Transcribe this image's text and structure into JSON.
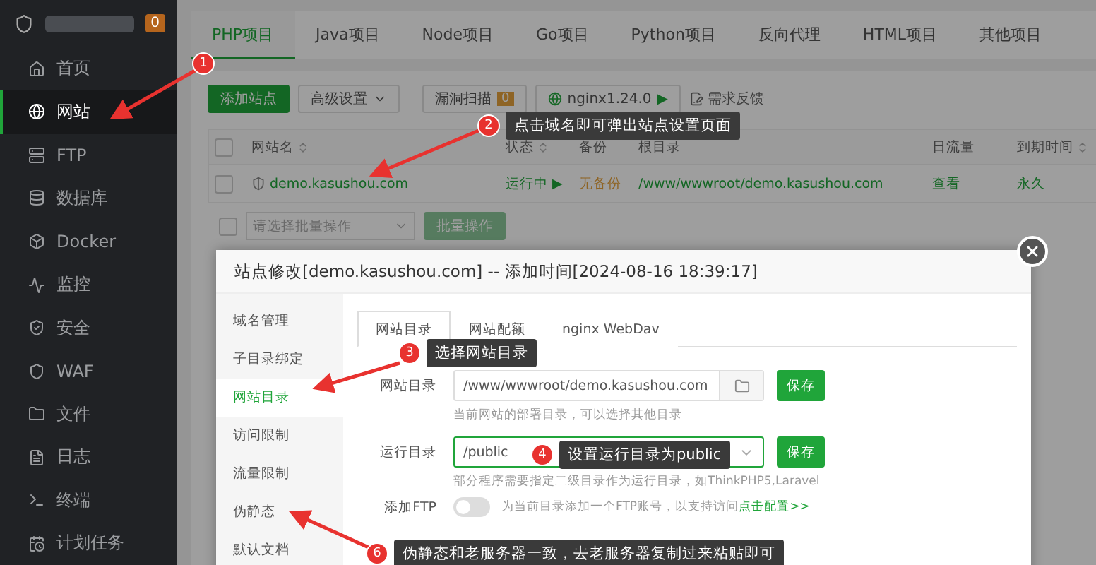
{
  "sidebar": {
    "badge": "0",
    "items": [
      {
        "label": "首页",
        "selected": false
      },
      {
        "label": "网站",
        "selected": true
      },
      {
        "label": "FTP",
        "selected": false
      },
      {
        "label": "数据库",
        "selected": false
      },
      {
        "label": "Docker",
        "selected": false
      },
      {
        "label": "监控",
        "selected": false
      },
      {
        "label": "安全",
        "selected": false
      },
      {
        "label": "WAF",
        "selected": false
      },
      {
        "label": "文件",
        "selected": false
      },
      {
        "label": "日志",
        "selected": false
      },
      {
        "label": "终端",
        "selected": false
      },
      {
        "label": "计划任务",
        "selected": false
      }
    ]
  },
  "project_tabs": [
    {
      "label": "PHP项目",
      "selected": true
    },
    {
      "label": "Java项目",
      "selected": false
    },
    {
      "label": "Node项目",
      "selected": false
    },
    {
      "label": "Go项目",
      "selected": false
    },
    {
      "label": "Python项目",
      "selected": false
    },
    {
      "label": "反向代理",
      "selected": false
    },
    {
      "label": "HTML项目",
      "selected": false
    },
    {
      "label": "其他项目",
      "selected": false
    }
  ],
  "toolbar": {
    "add_site": "添加站点",
    "advanced": "高级设置",
    "scan": "漏洞扫描",
    "scan_count": "0",
    "webserver": "nginx1.24.0",
    "webserver_arrow": "▶",
    "feedback": "需求反馈"
  },
  "table": {
    "select_all_checked": false,
    "columns": [
      {
        "label": "网站名",
        "sortable": true
      },
      {
        "label": "状态",
        "sortable": true
      },
      {
        "label": "备份",
        "sortable": false
      },
      {
        "label": "根目录",
        "sortable": false
      },
      {
        "label": "日流量",
        "sortable": false
      },
      {
        "label": "到期时间",
        "sortable": true
      }
    ],
    "rows": [
      {
        "checked": false,
        "name": "demo.kasushou.com",
        "status": "运行中",
        "status_arrow": "▶",
        "backup": "无备份",
        "root": "/www/wwwroot/demo.kasushou.com",
        "traffic": "查看",
        "expiry": "永久"
      }
    ]
  },
  "batch": {
    "checked": false,
    "placeholder": "请选择批量操作",
    "button": "批量操作"
  },
  "dialog": {
    "title": "站点修改[demo.kasushou.com] -- 添加时间[2024-08-16 18:39:17]",
    "menu": [
      {
        "label": "域名管理",
        "selected": false
      },
      {
        "label": "子目录绑定",
        "selected": false
      },
      {
        "label": "网站目录",
        "selected": true
      },
      {
        "label": "访问限制",
        "selected": false
      },
      {
        "label": "流量限制",
        "selected": false
      },
      {
        "label": "伪静态",
        "selected": false
      },
      {
        "label": "默认文档",
        "selected": false
      }
    ],
    "tabs": [
      {
        "label": "网站目录",
        "selected": true
      },
      {
        "label": "网站配额",
        "selected": false
      },
      {
        "label": "nginx WebDav",
        "selected": false
      }
    ],
    "fields": [
      {
        "kind": "path",
        "label": "网站目录",
        "value": "/www/wwwroot/demo.kasushou.com",
        "button": "保存",
        "hint": "当前网站的部署目录，可以选择其他目录"
      },
      {
        "kind": "select",
        "label": "运行目录",
        "value": "/public",
        "button": "保存",
        "hint": "部分程序需要指定二级目录作为运行目录，如ThinkPHP5,Laravel"
      }
    ],
    "ftp": {
      "label": "添加FTP",
      "on": false,
      "text": "为当前目录添加一个FTP账号，以支持访问",
      "link": "点击配置>>"
    }
  },
  "annotations": [
    {
      "number": "1"
    },
    {
      "number": "2",
      "text": "点击域名即可弹出站点设置页面"
    },
    {
      "number": "3",
      "text": "选择网站目录"
    },
    {
      "number": "4",
      "text": "设置运行目录为public"
    },
    {
      "number": "6",
      "text": "伪静态和老服务器一致，去老服务器复制过来粘贴即可"
    }
  ]
}
